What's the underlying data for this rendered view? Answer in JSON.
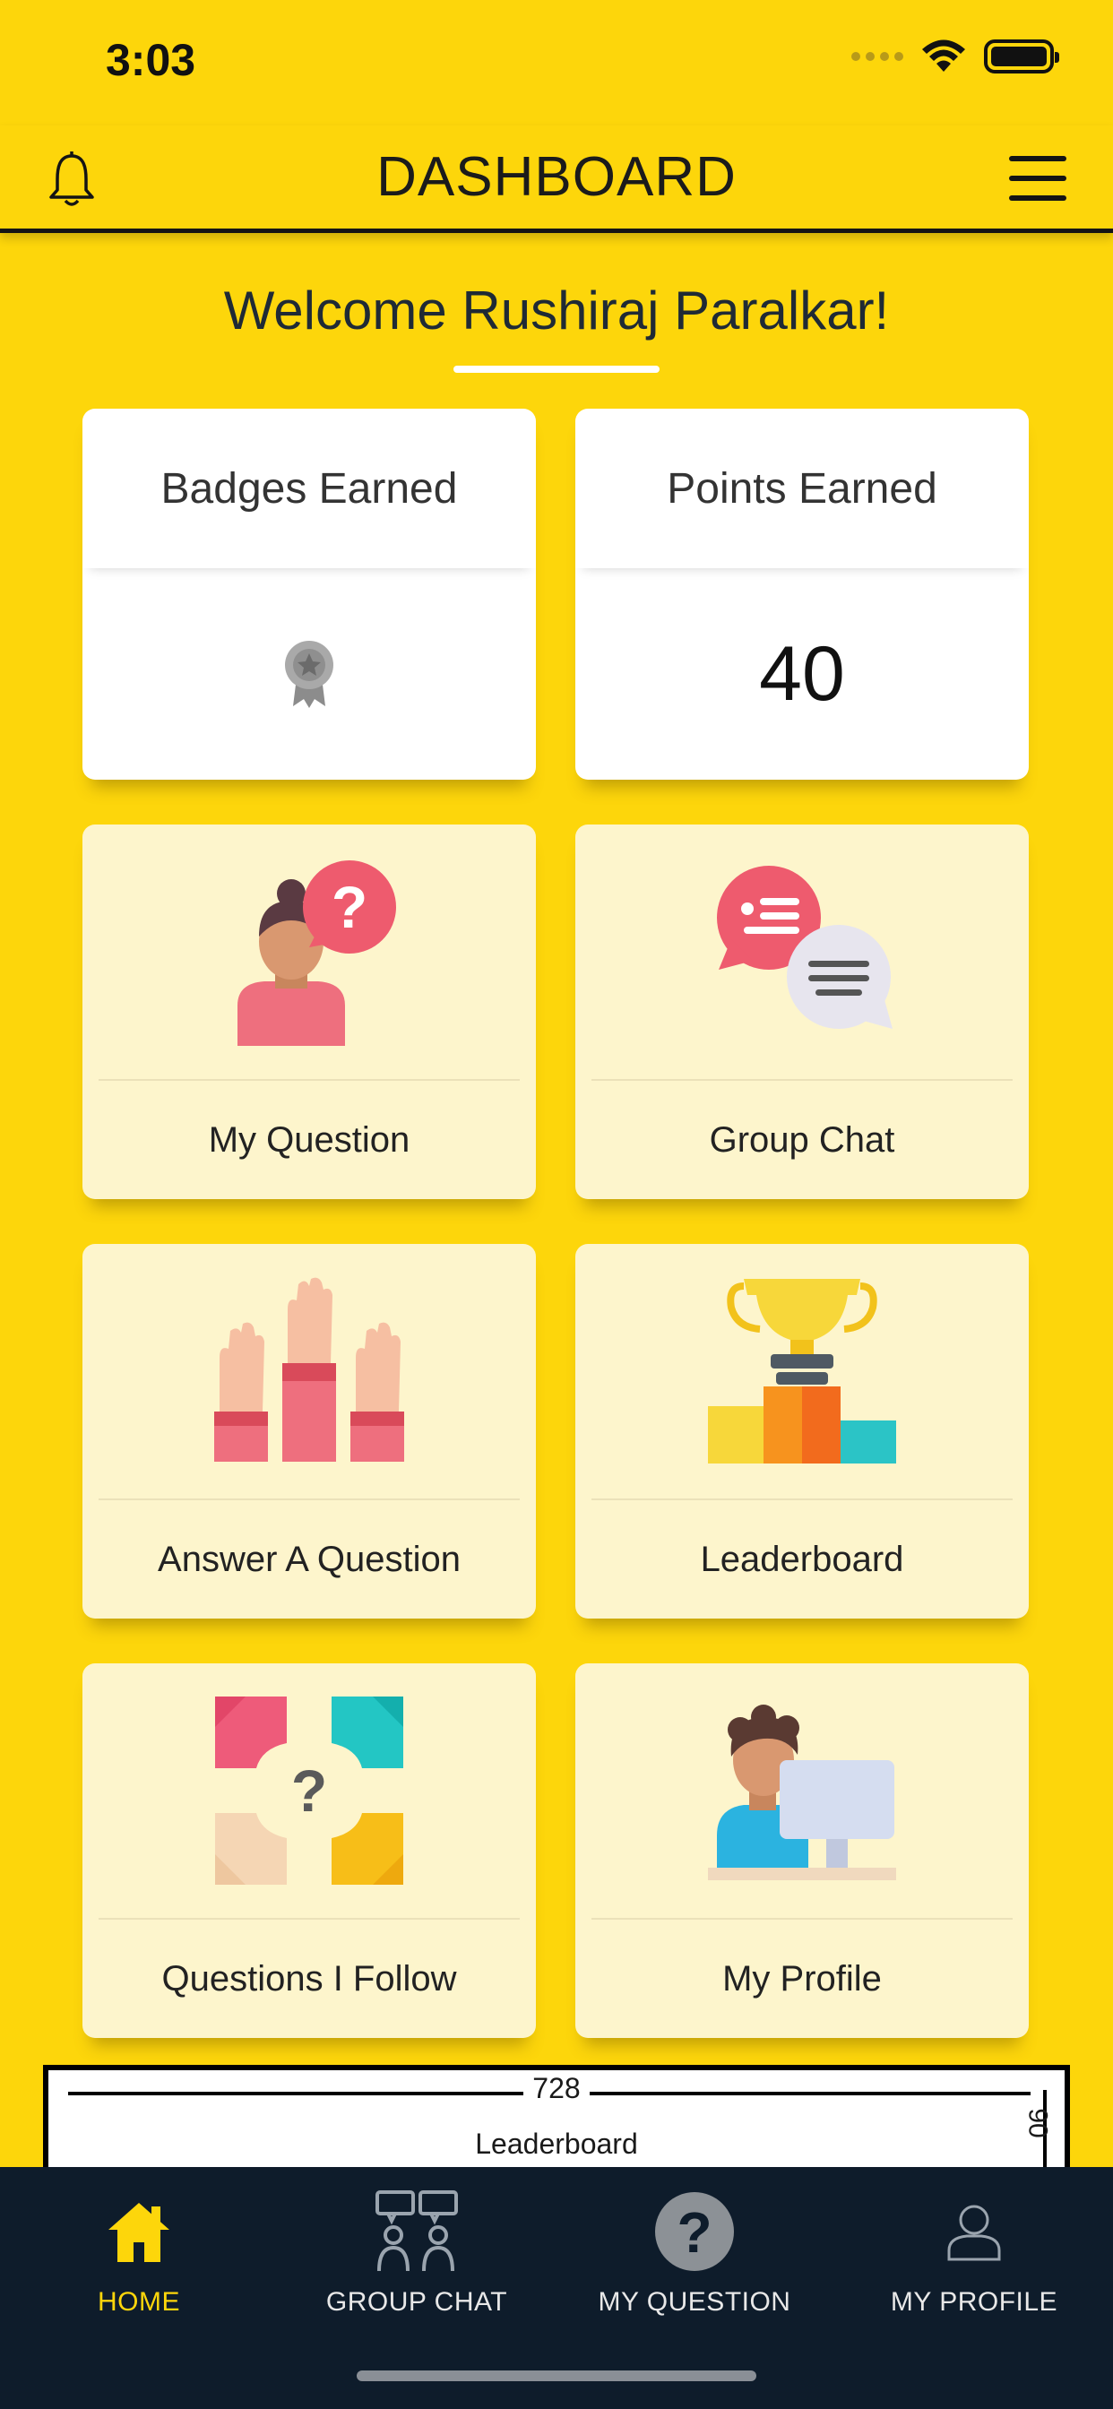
{
  "status": {
    "time": "3:03"
  },
  "header": {
    "title": "DASHBOARD"
  },
  "welcome": "Welcome Rushiraj Paralkar!",
  "stats": {
    "badges_title": "Badges Earned",
    "points_title": "Points Earned",
    "points_value": "40"
  },
  "tiles": [
    {
      "label": "My Question"
    },
    {
      "label": "Group Chat"
    },
    {
      "label": "Answer A Question"
    },
    {
      "label": "Leaderboard"
    },
    {
      "label": "Questions I Follow"
    },
    {
      "label": "My Profile"
    }
  ],
  "ad": {
    "width_label": "728",
    "text": "Leaderboard",
    "height_label": "90"
  },
  "tabs": [
    {
      "label": "HOME",
      "icon": "home-icon",
      "active": true
    },
    {
      "label": "GROUP CHAT",
      "icon": "group-chat-icon"
    },
    {
      "label": "MY QUESTION",
      "icon": "question-icon"
    },
    {
      "label": "MY PROFILE",
      "icon": "profile-icon"
    }
  ],
  "colors": {
    "brand": "#FDD60B",
    "tab_bar": "#0E1C2B",
    "tile": "#FDF5CC"
  }
}
